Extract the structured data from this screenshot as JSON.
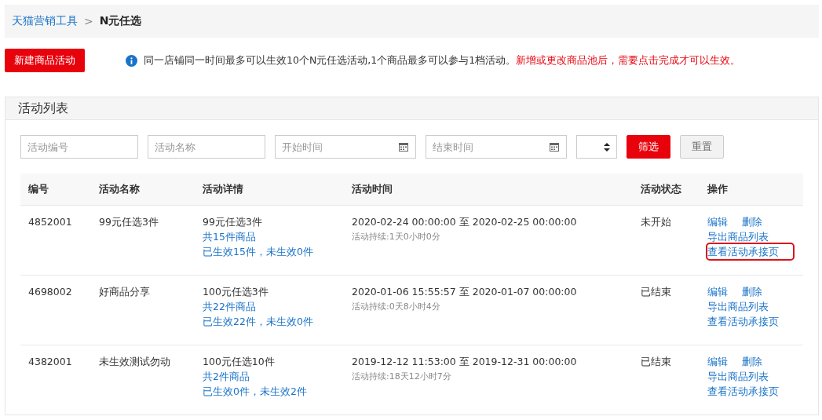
{
  "breadcrumb": {
    "parent": "天猫营销工具",
    "separator": ">",
    "current": "N元任选"
  },
  "new_button": "新建商品活动",
  "notice": {
    "text": "同一店铺同一时间最多可以生效10个N元任选活动,1个商品最多可以参与1档活动。",
    "warning": "新增或更改商品池后，需要点击完成才可以生效。"
  },
  "panel_title": "活动列表",
  "filters": [
    {
      "kind": "text",
      "placeholder": "活动编号"
    },
    {
      "kind": "text",
      "placeholder": "活动名称"
    },
    {
      "kind": "date",
      "placeholder": "开始时间"
    },
    {
      "kind": "date",
      "placeholder": "结束时间"
    },
    {
      "kind": "select"
    }
  ],
  "filter_button": "筛选",
  "reset_button": "重置",
  "columns": [
    "编号",
    "活动名称",
    "活动详情",
    "活动时间",
    "活动状态",
    "操作"
  ],
  "rows": [
    {
      "id": "4852001",
      "name": "99元任选3件",
      "detail": "99元任选3件",
      "count": "共15件商品",
      "effect": "已生效15件，未生效0件",
      "time": "2020-02-24 00:00:00 至 2020-02-25 00:00:00",
      "duration": "活动持续:1天0小时0分",
      "status": "未开始",
      "actions": [
        {
          "label": "编辑",
          "highlighted": false
        },
        {
          "label": "删除",
          "highlighted": false
        },
        {
          "label": "导出商品列表",
          "highlighted": false
        },
        {
          "label": "查看活动承接页",
          "highlighted": true
        }
      ]
    },
    {
      "id": "4698002",
      "name": "好商品分享",
      "detail": "100元任选3件",
      "count": "共22件商品",
      "effect": "已生效22件，未生效0件",
      "time": "2020-01-06 15:55:57 至 2020-01-07 00:00:00",
      "duration": "活动持续:0天8小时4分",
      "status": "已结束",
      "actions": [
        {
          "label": "编辑",
          "highlighted": false
        },
        {
          "label": "删除",
          "highlighted": false
        },
        {
          "label": "导出商品列表",
          "highlighted": false
        },
        {
          "label": "查看活动承接页",
          "highlighted": false
        }
      ]
    },
    {
      "id": "4382001",
      "name": "未生效测试勿动",
      "detail": "100元任选10件",
      "count": "共2件商品",
      "effect": "已生效0件，未生效2件",
      "time": "2019-12-12 11:53:00 至 2019-12-31 00:00:00",
      "duration": "活动持续:18天12小时7分",
      "status": "已结束",
      "actions": [
        {
          "label": "编辑",
          "highlighted": false
        },
        {
          "label": "删除",
          "highlighted": false
        },
        {
          "label": "导出商品列表",
          "highlighted": false
        },
        {
          "label": "查看活动承接页",
          "highlighted": false
        }
      ]
    }
  ]
}
